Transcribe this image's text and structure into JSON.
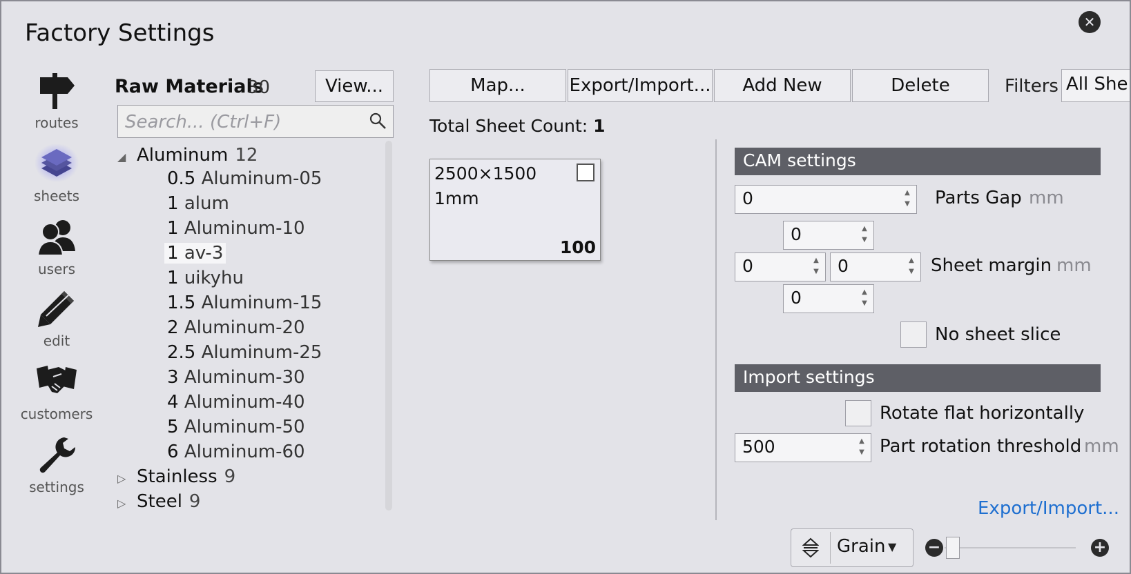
{
  "window": {
    "title": "Factory Settings"
  },
  "nav": [
    {
      "label": "routes",
      "icon": "signpost-icon"
    },
    {
      "label": "sheets",
      "icon": "layers-icon",
      "active": true
    },
    {
      "label": "users",
      "icon": "users-icon"
    },
    {
      "label": "edit",
      "icon": "pencil-icon"
    },
    {
      "label": "customers",
      "icon": "handshake-icon"
    },
    {
      "label": "settings",
      "icon": "wrench-icon"
    }
  ],
  "materials": {
    "title": "Raw Materials",
    "count": "30",
    "view_button": "View...",
    "search_placeholder": "Search... (Ctrl+F)",
    "groups": [
      {
        "name": "Aluminum",
        "count": "12",
        "expanded": true,
        "items": [
          {
            "thickness": "0.5",
            "name": "Aluminum-05"
          },
          {
            "thickness": "1",
            "name": "alum"
          },
          {
            "thickness": "1",
            "name": "Aluminum-10"
          },
          {
            "thickness": "1",
            "name": "av-3",
            "selected": true
          },
          {
            "thickness": "1",
            "name": "uikyhu"
          },
          {
            "thickness": "1.5",
            "name": "Aluminum-15"
          },
          {
            "thickness": "2",
            "name": "Aluminum-20"
          },
          {
            "thickness": "2.5",
            "name": "Aluminum-25"
          },
          {
            "thickness": "3",
            "name": "Aluminum-30"
          },
          {
            "thickness": "4",
            "name": "Aluminum-40"
          },
          {
            "thickness": "5",
            "name": "Aluminum-50"
          },
          {
            "thickness": "6",
            "name": "Aluminum-60"
          }
        ]
      },
      {
        "name": "Stainless",
        "count": "9",
        "expanded": false
      },
      {
        "name": "Steel",
        "count": "9",
        "expanded": false
      }
    ]
  },
  "toolbar": {
    "map": "Map...",
    "export_import": "Export/Import...",
    "add_new": "Add New",
    "delete": "Delete",
    "filters_label": "Filters",
    "filter_value": "All She"
  },
  "sheets": {
    "total_label": "Total Sheet Count: ",
    "total_value": "1",
    "card": {
      "dimensions": "2500×1500",
      "thickness": "1mm",
      "quantity": "100"
    }
  },
  "cam": {
    "header": "CAM settings",
    "parts_gap_value": "0",
    "parts_gap_label": "Parts Gap",
    "unit": "mm",
    "margin_top": "0",
    "margin_left": "0",
    "margin_right": "0",
    "margin_bottom": "0",
    "sheet_margin_label": "Sheet margin",
    "no_sheet_slice_label": "No sheet slice"
  },
  "import": {
    "header": "Import settings",
    "rotate_label": "Rotate flat horizontally",
    "threshold_value": "500",
    "threshold_label": "Part rotation threshold",
    "unit": "mm"
  },
  "footer": {
    "export_link": "Export/Import...",
    "grain_label": "Grain",
    "zoom_level": 0.03
  }
}
